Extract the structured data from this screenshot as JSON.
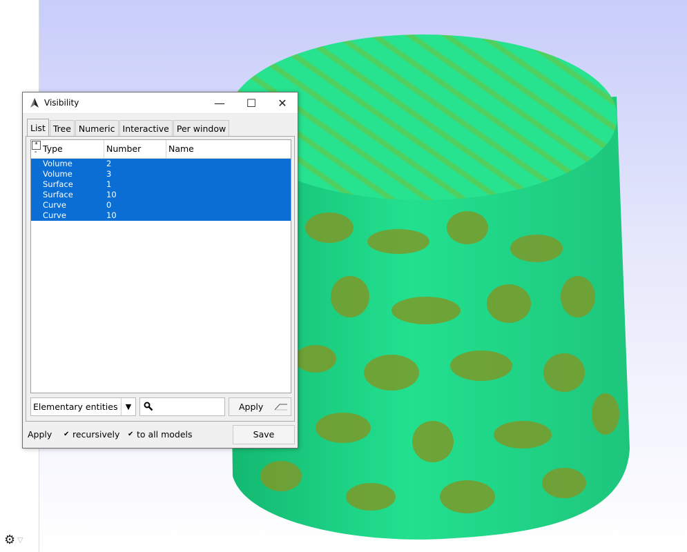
{
  "dialog": {
    "title": "Visibility",
    "tabs": [
      "List",
      "Tree",
      "Numeric",
      "Interactive",
      "Per window"
    ],
    "active_tab": "List",
    "columns": [
      "Type",
      "Number",
      "Name"
    ],
    "select_all_glyph": "*",
    "select_none_glyph": "-",
    "rows": [
      {
        "type": "Volume",
        "number": "2",
        "name": ""
      },
      {
        "type": "Volume",
        "number": "3",
        "name": ""
      },
      {
        "type": "Surface",
        "number": "1",
        "name": ""
      },
      {
        "type": "Surface",
        "number": "10",
        "name": ""
      },
      {
        "type": "Curve",
        "number": "0",
        "name": ""
      },
      {
        "type": "Curve",
        "number": "10",
        "name": ""
      }
    ],
    "entity_type_select": "Elementary entities",
    "search": {
      "value": "",
      "placeholder": ""
    },
    "apply_filter_label": "Apply",
    "apply_label": "Apply",
    "recursively_label": "recursively",
    "recursively_checked": true,
    "all_models_label": "to all models",
    "all_models_checked": true,
    "save_label": "Save",
    "selection_color": "#0a6ed4"
  },
  "viewport": {
    "mesh_color": "#1fe08c",
    "pattern_color": "#7c9a2a",
    "background_top": "#c8cdfa",
    "background_bottom": "#ffffff"
  },
  "status": {
    "settings_icon": "gear-icon"
  }
}
